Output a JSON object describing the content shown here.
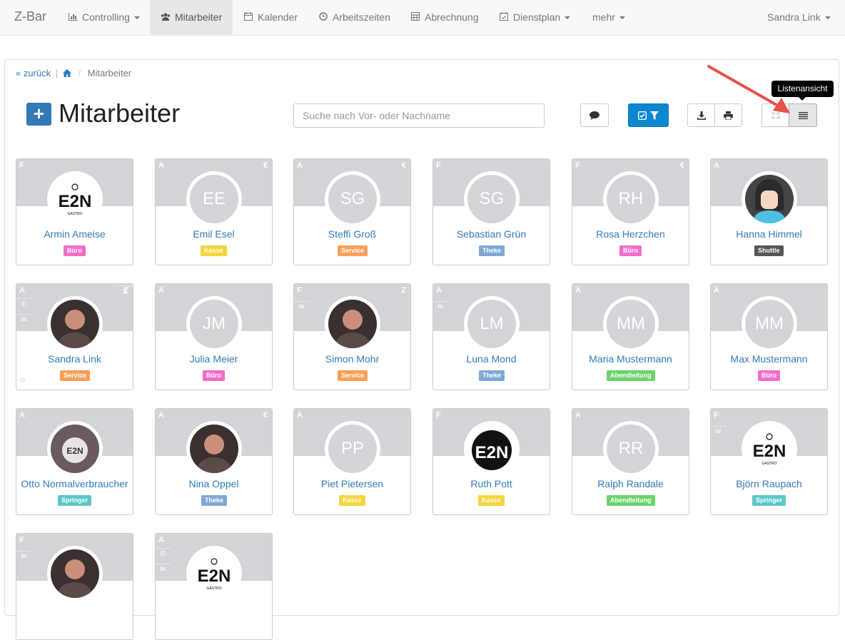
{
  "nav": {
    "brand": "Z-Bar",
    "items": [
      {
        "label": "Controlling",
        "icon": "bar-chart-icon",
        "dropdown": true
      },
      {
        "label": "Mitarbeiter",
        "icon": "users-icon",
        "active": true
      },
      {
        "label": "Kalender",
        "icon": "calendar-icon"
      },
      {
        "label": "Arbeitszeiten",
        "icon": "clock-icon"
      },
      {
        "label": "Abrechnung",
        "icon": "calculator-icon"
      },
      {
        "label": "Dienstplan",
        "icon": "calendar-check-icon",
        "dropdown": true
      },
      {
        "label": "mehr",
        "dropdown": true
      }
    ],
    "user": "Sandra Link"
  },
  "breadcrumb": {
    "back": "zurück",
    "home_icon": "home-icon",
    "current": "Mitarbeiter"
  },
  "header": {
    "add_label": "+",
    "title": "Mitarbeiter"
  },
  "search": {
    "placeholder": "Suche nach Vor- oder Nachname",
    "value": ""
  },
  "tooltip": "Listenansicht",
  "colors": {
    "primary": "#337ab7",
    "filter_button": "#0d86d0",
    "card_header": "#d3d4d7"
  },
  "employees": [
    {
      "name": "Armin Ameise",
      "dept": "Büro",
      "dept_color": "#f06ec8",
      "tag_left": "F",
      "tag_right": "",
      "initials": "",
      "photo": "e2n-logo"
    },
    {
      "name": "Emil Esel",
      "dept": "Kasse",
      "dept_color": "#f5d63c",
      "tag_left": "A",
      "tag_right": "€",
      "initials": "EE"
    },
    {
      "name": "Steffi Groß",
      "dept": "Service",
      "dept_color": "#f5a05a",
      "tag_left": "A",
      "tag_right": "€",
      "initials": "SG"
    },
    {
      "name": "Sebastian Grün",
      "dept": "Theke",
      "dept_color": "#7fa8d6",
      "tag_left": "F",
      "tag_right": "",
      "initials": "SG"
    },
    {
      "name": "Rosa Herzchen",
      "dept": "Büro",
      "dept_color": "#f06ec8",
      "tag_left": "F",
      "tag_right": "€",
      "initials": "RH"
    },
    {
      "name": "Hanna Himmel",
      "dept": "Shuttle",
      "dept_color": "#555555",
      "tag_left": "A",
      "tag_right": "",
      "initials": "",
      "photo": "cartoon-avatar"
    },
    {
      "name": "Sandra Link",
      "dept": "Service",
      "dept_color": "#f5a05a",
      "tag_left": "A",
      "tag_right": "Z",
      "initials": "",
      "photo": "portrait"
    },
    {
      "name": "Julia Meier",
      "dept": "Büro",
      "dept_color": "#f06ec8",
      "tag_left": "A",
      "tag_right": "",
      "initials": "JM"
    },
    {
      "name": "Simon Mohr",
      "dept": "Service",
      "dept_color": "#f5a05a",
      "tag_left": "F",
      "tag_right": "Z",
      "initials": "",
      "photo": "portrait"
    },
    {
      "name": "Luna Mond",
      "dept": "Theke",
      "dept_color": "#7fa8d6",
      "tag_left": "A",
      "tag_right": "",
      "initials": "LM"
    },
    {
      "name": "Maria Mustermann",
      "dept": "Abendleitung",
      "dept_color": "#6cd36c",
      "tag_left": "A",
      "tag_right": "",
      "initials": "MM"
    },
    {
      "name": "Max Mustermann",
      "dept": "Büro",
      "dept_color": "#f06ec8",
      "tag_left": "A",
      "tag_right": "",
      "initials": "MM"
    },
    {
      "name": "Otto Normalverbraucher",
      "dept": "Springer",
      "dept_color": "#5bc8c8",
      "tag_left": "A",
      "tag_right": "",
      "initials": "",
      "photo": "e2n-logo-gray"
    },
    {
      "name": "Nina Oppel",
      "dept": "Theke",
      "dept_color": "#7fa8d6",
      "tag_left": "A",
      "tag_right": "€",
      "initials": "",
      "photo": "portrait"
    },
    {
      "name": "Piet Pietersen",
      "dept": "Kasse",
      "dept_color": "#f5d63c",
      "tag_left": "A",
      "tag_right": "",
      "initials": "PP"
    },
    {
      "name": "Ruth Pott",
      "dept": "Kasse",
      "dept_color": "#f5d63c",
      "tag_left": "F",
      "tag_right": "",
      "initials": "",
      "photo": "e2n-logo-black"
    },
    {
      "name": "Ralph Randale",
      "dept": "Abendleitung",
      "dept_color": "#6cd36c",
      "tag_left": "A",
      "tag_right": "",
      "initials": "RR"
    },
    {
      "name": "Björn Raupach",
      "dept": "Springer",
      "dept_color": "#5bc8c8",
      "tag_left": "F",
      "tag_right": "",
      "initials": "",
      "photo": "e2n-logo"
    },
    {
      "name": "",
      "dept": "",
      "tag_left": "F",
      "initials": "",
      "photo": "portrait"
    },
    {
      "name": "",
      "dept": "",
      "tag_left": "A",
      "initials": "",
      "photo": "e2n-logo"
    }
  ]
}
